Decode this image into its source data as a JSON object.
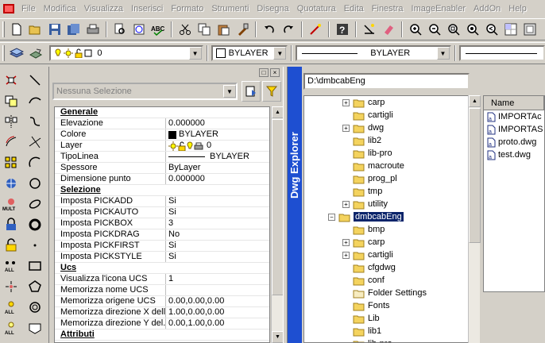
{
  "menu": [
    "File",
    "Modifica",
    "Visualizza",
    "Inserisci",
    "Formato",
    "Strumenti",
    "Disegna",
    "Quotatura",
    "Edita",
    "Finestra",
    "ImageEnabler",
    "AddOn",
    "Help"
  ],
  "toolbar1": {
    "icons": [
      "new-icon",
      "open-icon",
      "save-icon",
      "save-all-icon",
      "print-icon",
      "print-preview-icon",
      "plot-icon",
      "spell-check-icon",
      "cut-icon",
      "copy-icon",
      "paste-icon",
      "match-properties-icon",
      "undo-icon",
      "redo-icon",
      "line-draw-icon",
      "help-icon",
      "pan-icon",
      "eraser-icon",
      "zoom-in-icon",
      "zoom-out-icon",
      "zoom-window-icon",
      "zoom-extents-icon",
      "zoom-previous-icon",
      "grid-icon",
      "view-icon"
    ]
  },
  "toolbar2": {
    "layer_value": "0",
    "color_value": "BYLAYER",
    "linetype_value": "BYLAYER"
  },
  "properties": {
    "selection": "Nessuna Selezione",
    "categories": [
      {
        "title": "Generale",
        "rows": [
          {
            "key": "Elevazione",
            "value": "0.000000"
          },
          {
            "key": "Colore",
            "value": "BYLAYER",
            "swatch": "#000000"
          },
          {
            "key": "Layer",
            "value": "0",
            "icons": true
          },
          {
            "key": "TipoLinea",
            "value": "BYLAYER",
            "line": true
          },
          {
            "key": "Spessore",
            "value": "ByLayer"
          },
          {
            "key": "Dimensione punto",
            "value": "0.000000"
          }
        ]
      },
      {
        "title": "Selezione",
        "rows": [
          {
            "key": "Imposta PICKADD",
            "value": "Si"
          },
          {
            "key": "Imposta PICKAUTO",
            "value": "Si"
          },
          {
            "key": "Imposta PICKBOX",
            "value": "3"
          },
          {
            "key": "Imposta PICKDRAG",
            "value": "No"
          },
          {
            "key": "Imposta PICKFIRST",
            "value": "Si"
          },
          {
            "key": "Imposta PICKSTYLE",
            "value": "Si"
          }
        ]
      },
      {
        "title": "Ucs",
        "rows": [
          {
            "key": "Visualizza l'icona UCS",
            "value": "1"
          },
          {
            "key": "Memorizza nome UCS",
            "value": ""
          },
          {
            "key": "Memorizza origene UCS",
            "value": "0.00,0.00,0.00"
          },
          {
            "key": "Memorizza direzione X dell...",
            "value": "1.00,0.00,0.00"
          },
          {
            "key": "Memorizza direzione Y del...",
            "value": "0.00,1.00,0.00"
          }
        ]
      },
      {
        "title": "Attributi",
        "rows": []
      }
    ]
  },
  "explorer": {
    "title": "Dwg Explorer",
    "path": "D:\\dmbcabEng",
    "tree": [
      {
        "label": "carp",
        "expander": "+",
        "depth": 1
      },
      {
        "label": "cartigli",
        "expander": "",
        "depth": 1
      },
      {
        "label": "dwg",
        "expander": "+",
        "depth": 1
      },
      {
        "label": "lib2",
        "expander": "",
        "depth": 1
      },
      {
        "label": "lib-pro",
        "expander": "",
        "depth": 1
      },
      {
        "label": "macroute",
        "expander": "",
        "depth": 1
      },
      {
        "label": "prog_pl",
        "expander": "",
        "depth": 1
      },
      {
        "label": "tmp",
        "expander": "",
        "depth": 1
      },
      {
        "label": "utility",
        "expander": "+",
        "depth": 1
      },
      {
        "label": "dmbcabEng",
        "expander": "-",
        "depth": 0,
        "selected": true
      },
      {
        "label": "bmp",
        "expander": "",
        "depth": 1
      },
      {
        "label": "carp",
        "expander": "+",
        "depth": 1
      },
      {
        "label": "cartigli",
        "expander": "+",
        "depth": 1
      },
      {
        "label": "cfgdwg",
        "expander": "",
        "depth": 1
      },
      {
        "label": "conf",
        "expander": "",
        "depth": 1
      },
      {
        "label": "Folder Settings",
        "expander": "",
        "depth": 1,
        "pale": true
      },
      {
        "label": "Fonts",
        "expander": "",
        "depth": 1
      },
      {
        "label": "Lib",
        "expander": "",
        "depth": 1
      },
      {
        "label": "lib1",
        "expander": "",
        "depth": 1
      },
      {
        "label": "lib-pro",
        "expander": "",
        "depth": 1
      }
    ],
    "list_header": "Name",
    "files": [
      "IMPORTAc",
      "IMPORTAS",
      "proto.dwg",
      "test.dwg"
    ]
  },
  "colors": {
    "selection": "#0a246a",
    "explorer_bar": "#1e4fd1",
    "folder": "#f4d35e"
  }
}
